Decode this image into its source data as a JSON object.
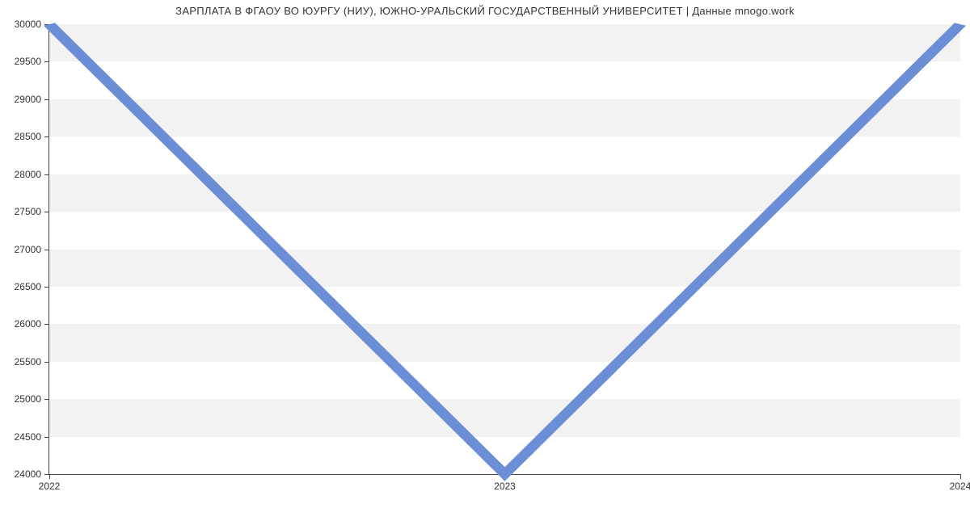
{
  "chart_data": {
    "type": "line",
    "title": "ЗАРПЛАТА В ФГАОУ ВО ЮУРГУ (НИУ), ЮЖНО-УРАЛЬСКИЙ ГОСУДАРСТВЕННЫЙ УНИВЕРСИТЕТ | Данные mnogo.work",
    "x": [
      "2022",
      "2023",
      "2024"
    ],
    "values": [
      30000,
      24000,
      30000
    ],
    "xlabel": "",
    "ylabel": "",
    "ylim": [
      24000,
      30000
    ],
    "yticks": [
      24000,
      24500,
      25000,
      25500,
      26000,
      26500,
      27000,
      27500,
      28000,
      28500,
      29000,
      29500,
      30000
    ],
    "colors": {
      "line": "#6b8ed6"
    }
  }
}
